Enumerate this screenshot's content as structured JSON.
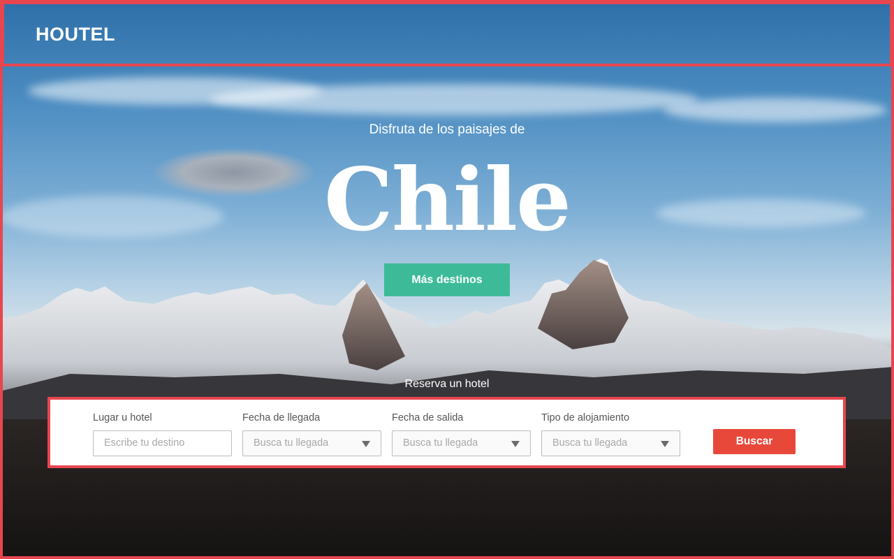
{
  "brand": {
    "logo": "HOUTEL"
  },
  "hero": {
    "subtitle": "Disfruta de los paisajes de",
    "headline": "Chile",
    "cta_label": "Más destinos"
  },
  "booking": {
    "label": "Reserva un hotel",
    "fields": [
      {
        "label": "Lugar u hotel",
        "placeholder": "Escribe tu destino",
        "type": "text"
      },
      {
        "label": "Fecha de llegada",
        "placeholder": "Busca tu llegada",
        "type": "select"
      },
      {
        "label": "Fecha de salida",
        "placeholder": "Busca tu llegada",
        "type": "select"
      },
      {
        "label": "Tipo de alojamiento",
        "placeholder": "Busca tu llegada",
        "type": "select"
      }
    ],
    "search_label": "Buscar"
  },
  "colors": {
    "accent_green": "#3dbb98",
    "accent_red": "#e8483a",
    "annotation_border": "#e8464f"
  }
}
